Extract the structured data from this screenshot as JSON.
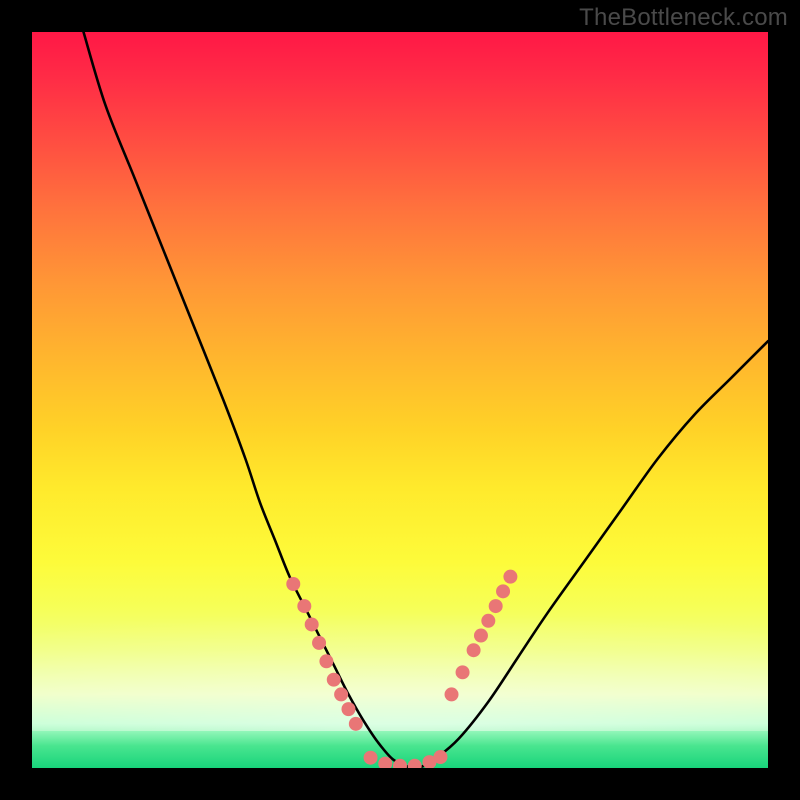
{
  "watermark": "TheBottleneck.com",
  "chart_data": {
    "type": "line",
    "title": "",
    "xlabel": "",
    "ylabel": "",
    "xlim": [
      0,
      100
    ],
    "ylim": [
      0,
      100
    ],
    "grid": false,
    "legend": false,
    "series": [
      {
        "name": "bottleneck-curve",
        "x": [
          7,
          10,
          14,
          18,
          22,
          26,
          29,
          31,
          33,
          35,
          37,
          39,
          41,
          43,
          45,
          47,
          49,
          51,
          53,
          55,
          58,
          62,
          66,
          70,
          75,
          80,
          85,
          90,
          95,
          100
        ],
        "y": [
          100,
          90,
          80,
          70,
          60,
          50,
          42,
          36,
          31,
          26,
          22,
          18,
          14,
          10,
          6.5,
          3.5,
          1.2,
          0.2,
          0.2,
          1.4,
          4,
          9,
          15,
          21,
          28,
          35,
          42,
          48,
          53,
          58
        ]
      }
    ],
    "markers": [
      {
        "name": "left-cluster",
        "x_pct": [
          35.5,
          37,
          38,
          39,
          40,
          41,
          42,
          43,
          44
        ],
        "y_pct": [
          25,
          22,
          19.5,
          17,
          14.5,
          12,
          10,
          8,
          6
        ]
      },
      {
        "name": "bottom-cluster",
        "x_pct": [
          46,
          48,
          50,
          52,
          54,
          55.5
        ],
        "y_pct": [
          1.4,
          0.6,
          0.3,
          0.3,
          0.8,
          1.5
        ]
      },
      {
        "name": "right-cluster",
        "x_pct": [
          57,
          58.5,
          60,
          61,
          62,
          63,
          64,
          65
        ],
        "y_pct": [
          10,
          13,
          16,
          18,
          20,
          22,
          24,
          26
        ]
      }
    ],
    "marker_color": "#e97676",
    "curve_color": "#000000"
  }
}
